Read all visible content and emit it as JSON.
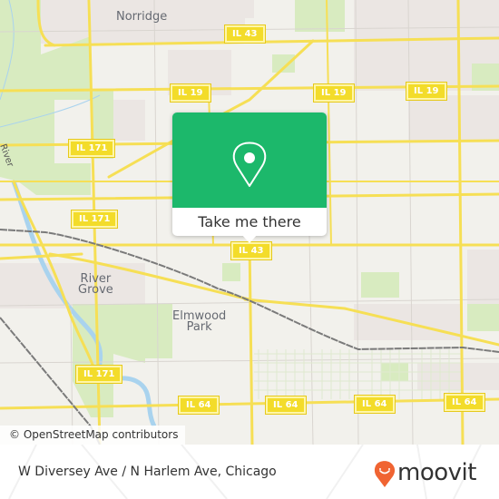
{
  "map": {
    "place_labels": [
      {
        "id": "norridge",
        "text": "Norridge"
      },
      {
        "id": "river-grove",
        "text": "River\nGrove"
      },
      {
        "id": "elmwood-park",
        "text": "Elmwood\nPark"
      }
    ],
    "river_label": "River",
    "shields": {
      "il43_top": "IL 43",
      "il19_a": "IL 19",
      "il19_b": "IL 19",
      "il19_c": "IL 19",
      "il171_a": "IL 171",
      "il171_b": "IL 171",
      "il171_c": "IL 171",
      "il43_mid": "IL 43",
      "il64_a": "IL 64",
      "il64_b": "IL 64",
      "il64_c": "IL 64",
      "il64_d": "IL 64"
    },
    "colors": {
      "background": "#f2f1ec",
      "park": "#d8ebc0",
      "residential": "#ebe6e3",
      "road_major": "#f6df55",
      "road_minor": "#d9d5d0",
      "water": "#a9d3ee",
      "rail": "#7a7a7a"
    }
  },
  "popup": {
    "cta_label": "Take me there",
    "icon": "map-pin-icon",
    "color": "#1cb86b"
  },
  "attribution": "© OpenStreetMap contributors",
  "footer": {
    "address": "W Diversey Ave / N Harlem Ave, Chicago",
    "logo_text": "moovit",
    "logo_color": "#f06432"
  }
}
